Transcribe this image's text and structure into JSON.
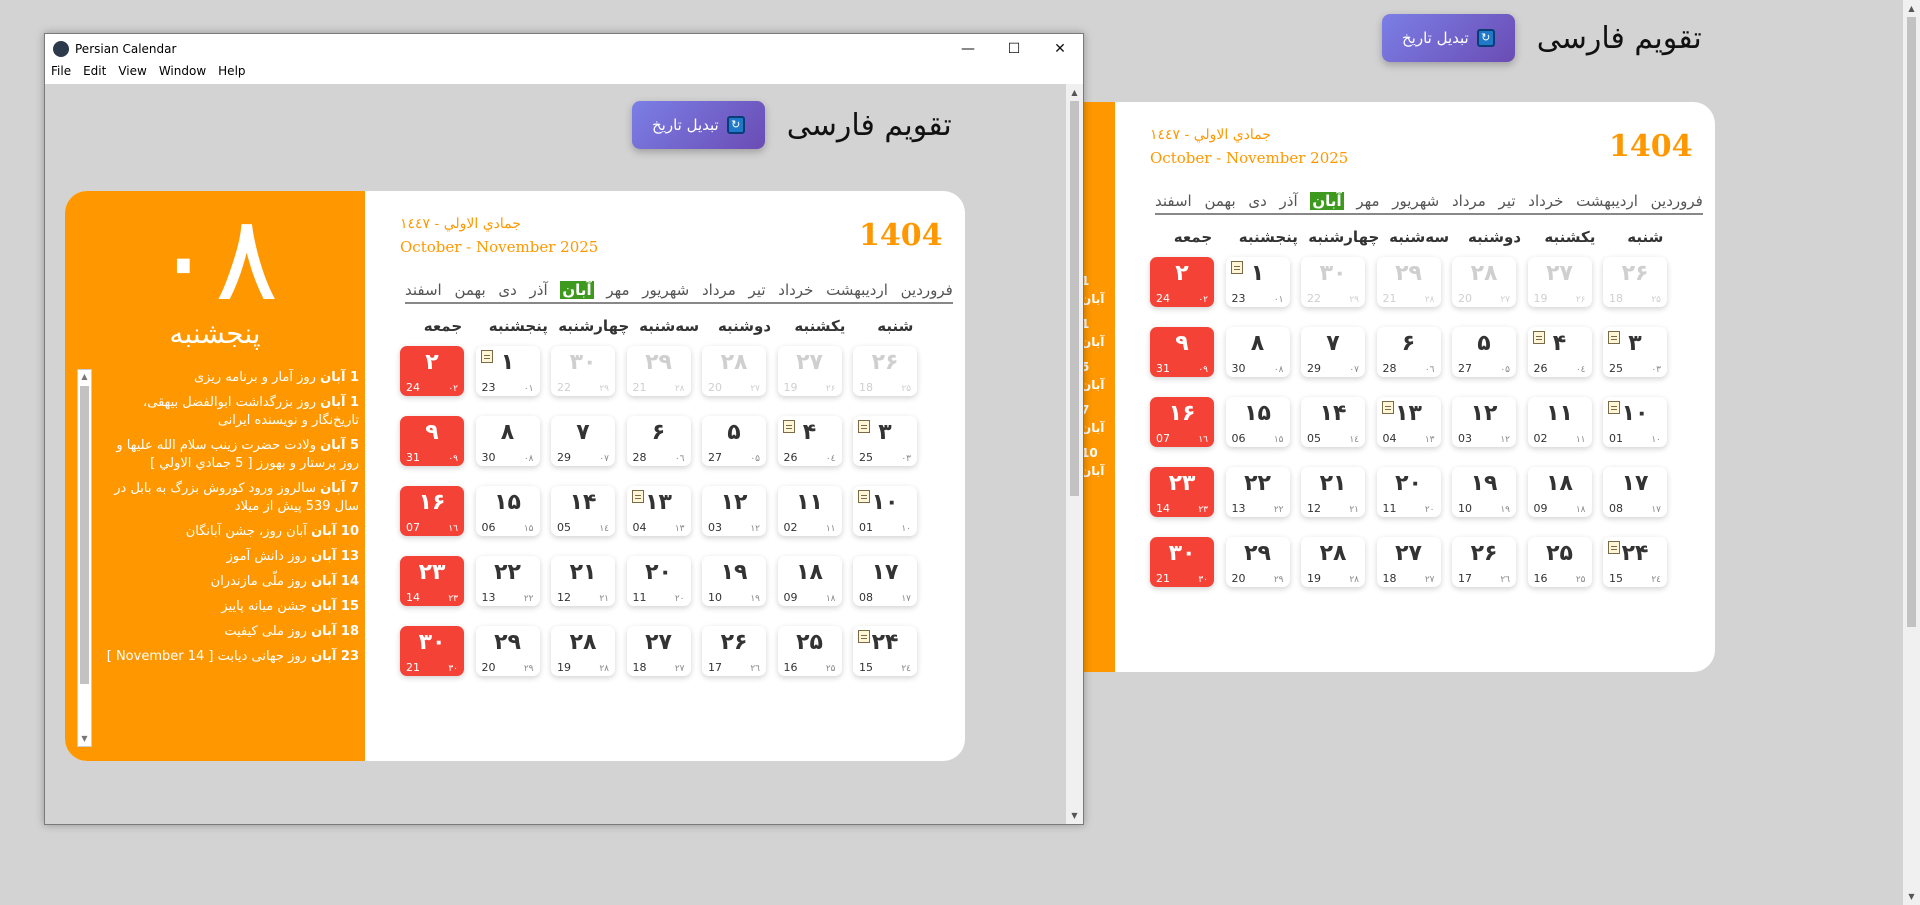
{
  "header": {
    "title": "تقویم فارسی",
    "convert_label": "تبدیل تاریخ"
  },
  "window": {
    "title": "Persian Calendar",
    "menu": [
      "File",
      "Edit",
      "View",
      "Window",
      "Help"
    ]
  },
  "calendar": {
    "year": "1404",
    "hijri": "جمادي الاولي - ١٤٤٧",
    "gregorian": "October - November 2025",
    "today_big": "۰۸",
    "today_weekday": "پنجشنبه",
    "months": [
      "فروردین",
      "اردیبهشت",
      "خرداد",
      "تیر",
      "مرداد",
      "شهریور",
      "مهر",
      "آبان",
      "آذر",
      "دی",
      "بهمن",
      "اسفند"
    ],
    "selected_month": "آبان",
    "weekdays": [
      "شنبه",
      "یکشنبه",
      "دوشنبه",
      "سه‌شنبه",
      "چهارشنبه",
      "پنجشنبه",
      "جمعه"
    ],
    "weeks": [
      [
        [
          "۲۶",
          "18",
          "۲۵",
          1,
          0
        ],
        [
          "۲۷",
          "19",
          "۲۶",
          1,
          0
        ],
        [
          "۲۸",
          "20",
          "۲۷",
          1,
          0
        ],
        [
          "۲۹",
          "21",
          "۲۸",
          1,
          0
        ],
        [
          "۳۰",
          "22",
          "۲۹",
          1,
          0
        ],
        [
          "۱",
          "23",
          "۰۱",
          0,
          1
        ],
        [
          "۲",
          "24",
          "۰۲",
          0,
          0
        ]
      ],
      [
        [
          "۳",
          "25",
          "۰۳",
          0,
          1
        ],
        [
          "۴",
          "26",
          "۰٤",
          0,
          1
        ],
        [
          "۵",
          "27",
          "۰۵",
          0,
          0
        ],
        [
          "۶",
          "28",
          "۰٦",
          0,
          0
        ],
        [
          "۷",
          "29",
          "۰۷",
          0,
          0
        ],
        [
          "۸",
          "30",
          "۰۸",
          0,
          0
        ],
        [
          "۹",
          "31",
          "۰۹",
          0,
          0
        ]
      ],
      [
        [
          "۱۰",
          "01",
          "۱۰",
          0,
          1
        ],
        [
          "۱۱",
          "02",
          "۱۱",
          0,
          0
        ],
        [
          "۱۲",
          "03",
          "۱۲",
          0,
          0
        ],
        [
          "۱۳",
          "04",
          "۱۳",
          0,
          1
        ],
        [
          "۱۴",
          "05",
          "۱٤",
          0,
          0
        ],
        [
          "۱۵",
          "06",
          "۱۵",
          0,
          0
        ],
        [
          "۱۶",
          "07",
          "۱٦",
          0,
          0
        ]
      ],
      [
        [
          "۱۷",
          "08",
          "۱۷",
          0,
          0
        ],
        [
          "۱۸",
          "09",
          "۱۸",
          0,
          0
        ],
        [
          "۱۹",
          "10",
          "۱۹",
          0,
          0
        ],
        [
          "۲۰",
          "11",
          "۲۰",
          0,
          0
        ],
        [
          "۲۱",
          "12",
          "۲۱",
          0,
          0
        ],
        [
          "۲۲",
          "13",
          "۲۲",
          0,
          0
        ],
        [
          "۲۳",
          "14",
          "۲۳",
          0,
          0
        ]
      ],
      [
        [
          "۲۴",
          "15",
          "۲٤",
          0,
          1
        ],
        [
          "۲۵",
          "16",
          "۲۵",
          0,
          0
        ],
        [
          "۲۶",
          "17",
          "۲٦",
          0,
          0
        ],
        [
          "۲۷",
          "18",
          "۲۷",
          0,
          0
        ],
        [
          "۲۸",
          "19",
          "۲۸",
          0,
          0
        ],
        [
          "۲۹",
          "20",
          "۲۹",
          0,
          0
        ],
        [
          "۳۰",
          "21",
          "۳۰",
          0,
          0
        ]
      ]
    ],
    "events": [
      {
        "date": "1 آبان",
        "text": "روز آمار و برنامه ریزی"
      },
      {
        "date": "1 آبان",
        "text": "روز بزرگداشت ابوالفضل بیهقی، تاریخ‌نگار و نویسنده ایرانی"
      },
      {
        "date": "5 آبان",
        "text": "ولادت حضرت زینب سلام الله علیها و روز پرستار و بهورز [ 5 جمادي الاولي ]"
      },
      {
        "date": "7 آبان",
        "text": "سالروز ورود کوروش بزرگ به بابل در سال 539 پیش از میلاد"
      },
      {
        "date": "10 آبان",
        "text": "آبان روز، جشن آبانگان"
      },
      {
        "date": "13 آبان",
        "text": "روز دانش آموز"
      },
      {
        "date": "14 آبان",
        "text": "روز ملّی مازندران"
      },
      {
        "date": "15 آبان",
        "text": "جشن میانه پاییز"
      },
      {
        "date": "18 آبان",
        "text": "روز ملی کیفیت"
      },
      {
        "date": "23 آبان",
        "text": "روز جهانی دیابت [ 14 November ]"
      }
    ]
  }
}
